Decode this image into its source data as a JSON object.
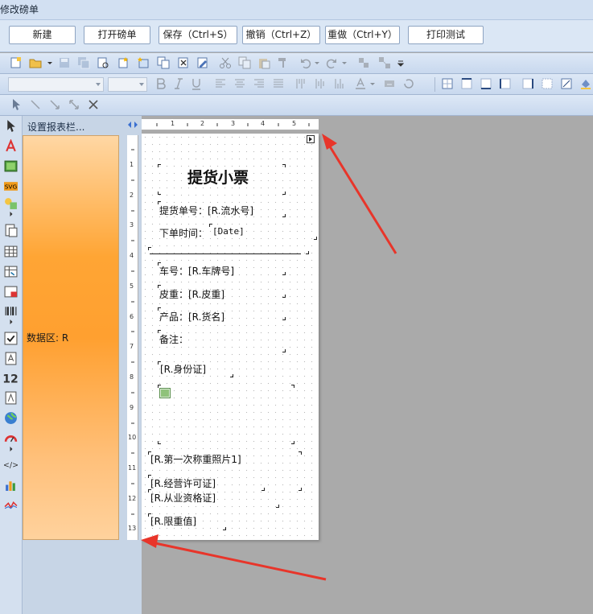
{
  "window": {
    "title": "修改磅单"
  },
  "actions": {
    "new_label": "新建",
    "open_label": "打开磅单",
    "save_label": "保存（Ctrl+S）",
    "undo_label": "撤销（Ctrl+Z）",
    "redo_label": "重做（Ctrl+Y）",
    "print_test_label": "打印测试"
  },
  "band_panel": {
    "header": "设置报表栏...",
    "data_band_label": "数据区: R"
  },
  "ruler": {
    "horizontal": [
      "1",
      "2",
      "3",
      "4",
      "5"
    ],
    "vertical": [
      "1",
      "2",
      "3",
      "4",
      "5",
      "6",
      "7",
      "8",
      "9",
      "10",
      "11",
      "12",
      "13"
    ]
  },
  "report": {
    "title": "提货小票",
    "fields": {
      "serial": "提货单号：[R.流水号]",
      "order_time_label": "下单时间：",
      "order_time_value": "[Date]",
      "plate": "车号：[R.车牌号]",
      "tare": "皮重：[R.皮重]",
      "product": "产品：[R.货名]",
      "remark": "备注：",
      "id_card": "[R.身份证]",
      "photo1": "[R.第一次称重照片1]",
      "license": "[R.经营许可证]",
      "qualification": "[R.从业资格证]",
      "limit": "[R.限重值]"
    }
  },
  "colors": {
    "band_orange": "#ffa534",
    "annotation_arrow": "#e8352a",
    "workspace_bg": "#aaaaaa"
  }
}
